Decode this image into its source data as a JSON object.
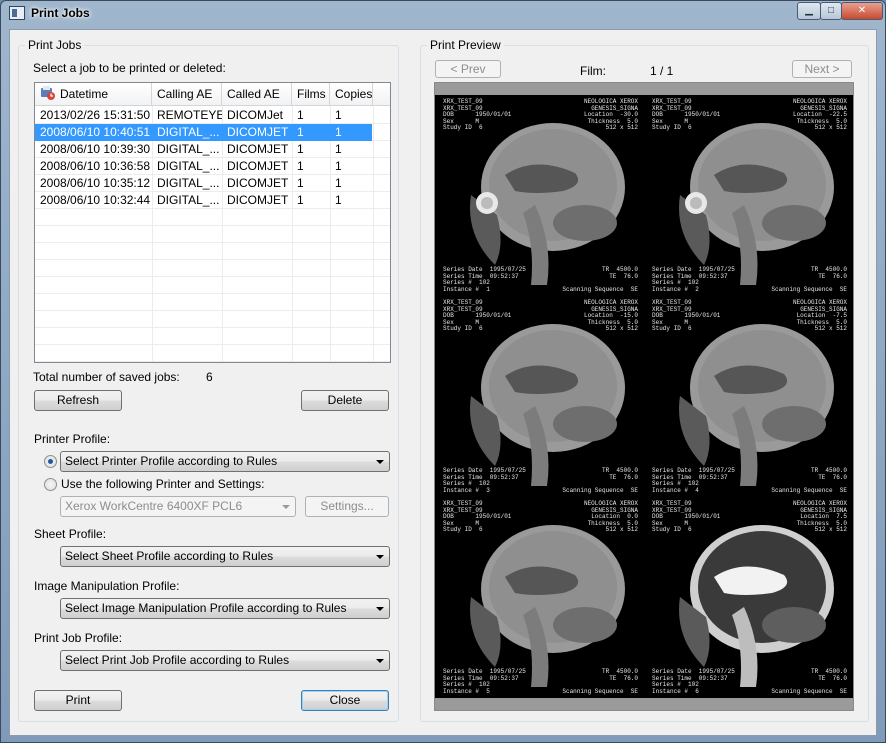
{
  "window": {
    "title": "Print Jobs"
  },
  "jobs_group": {
    "title": "Print Jobs",
    "instruction": "Select a job to be printed or deleted:",
    "columns": [
      "Datetime",
      "Calling AE",
      "Called AE",
      "Films",
      "Copies"
    ],
    "rows": [
      [
        "2013/02/26 15:31:50",
        "REMOTEYE",
        "DICOMJet",
        "1",
        "1"
      ],
      [
        "2008/06/10 10:40:51",
        "DIGITAL_...",
        "DICOMJET",
        "1",
        "1"
      ],
      [
        "2008/06/10 10:39:30",
        "DIGITAL_...",
        "DICOMJET",
        "1",
        "1"
      ],
      [
        "2008/06/10 10:36:58",
        "DIGITAL_...",
        "DICOMJET",
        "1",
        "1"
      ],
      [
        "2008/06/10 10:35:12",
        "DIGITAL_...",
        "DICOMJET",
        "1",
        "1"
      ],
      [
        "2008/06/10 10:32:44",
        "DIGITAL_...",
        "DICOMJET",
        "1",
        "1"
      ]
    ],
    "selected_row": 1,
    "total_label": "Total number of saved jobs:",
    "total_value": "6",
    "refresh_label": "Refresh",
    "delete_label": "Delete"
  },
  "printer_profile": {
    "label": "Printer Profile:",
    "option_rules": "Select Printer Profile according to Rules",
    "option_following": "Use the following Printer and Settings:",
    "printer_value": "Xerox WorkCentre 6400XF PCL6",
    "settings_label": "Settings..."
  },
  "sheet_profile": {
    "label": "Sheet Profile:",
    "value": "Select Sheet Profile according to Rules"
  },
  "image_profile": {
    "label": "Image Manipulation Profile:",
    "value": "Select Image Manipulation Profile according to Rules"
  },
  "job_profile": {
    "label": "Print Job Profile:",
    "value": "Select Print Job Profile according to Rules"
  },
  "footer": {
    "print_label": "Print",
    "close_label": "Close"
  },
  "preview": {
    "title": "Print Preview",
    "prev_label": "< Prev",
    "next_label": "Next >",
    "film_label": "Film:",
    "film_value": "1 / 1",
    "tiles": [
      {
        "loc": "Location  -30.0",
        "num": "1",
        "inst": "Instance #  1",
        "te": "TE  76.0",
        "seq": "Scanning Sequence  SE"
      },
      {
        "loc": "Location  -22.5",
        "num": "2",
        "inst": "Instance #  2",
        "te": "TE  76.0",
        "seq": "Scanning Sequence  SE"
      },
      {
        "loc": "Location  -15.0",
        "num": "3",
        "inst": "Instance #  3",
        "te": "TE  76.0",
        "seq": "Scanning Sequence  SE"
      },
      {
        "loc": "Location  -7.5",
        "num": "4",
        "inst": "Instance #  4",
        "te": "TE  76.0",
        "seq": "Scanning Sequence  SE"
      },
      {
        "loc": "Location  0.0",
        "num": "5",
        "inst": "Instance #  5",
        "te": "TE  76.0",
        "seq": "Scanning Sequence  SE"
      },
      {
        "loc": "Location  7.5",
        "num": "6",
        "inst": "Instance #  6",
        "te": "TE  76.0",
        "seq": "Scanning Sequence  SE"
      }
    ],
    "overlay": {
      "patient": "XRX_TEST_09",
      "org": "NEOLOGICA XEROX",
      "device": "GENESIS_SIGNA",
      "dob": "DOB      1950/01/01",
      "sex": "Sex      M",
      "study": "Study ID  6",
      "thickness": "Thickness  5.0",
      "matrix": "512 x 512",
      "series_date": "Series Date  1995/07/25",
      "series_time": "Series Time  09:52:37",
      "series_num": "Series #  102",
      "tr": "TR  4500.0"
    }
  }
}
